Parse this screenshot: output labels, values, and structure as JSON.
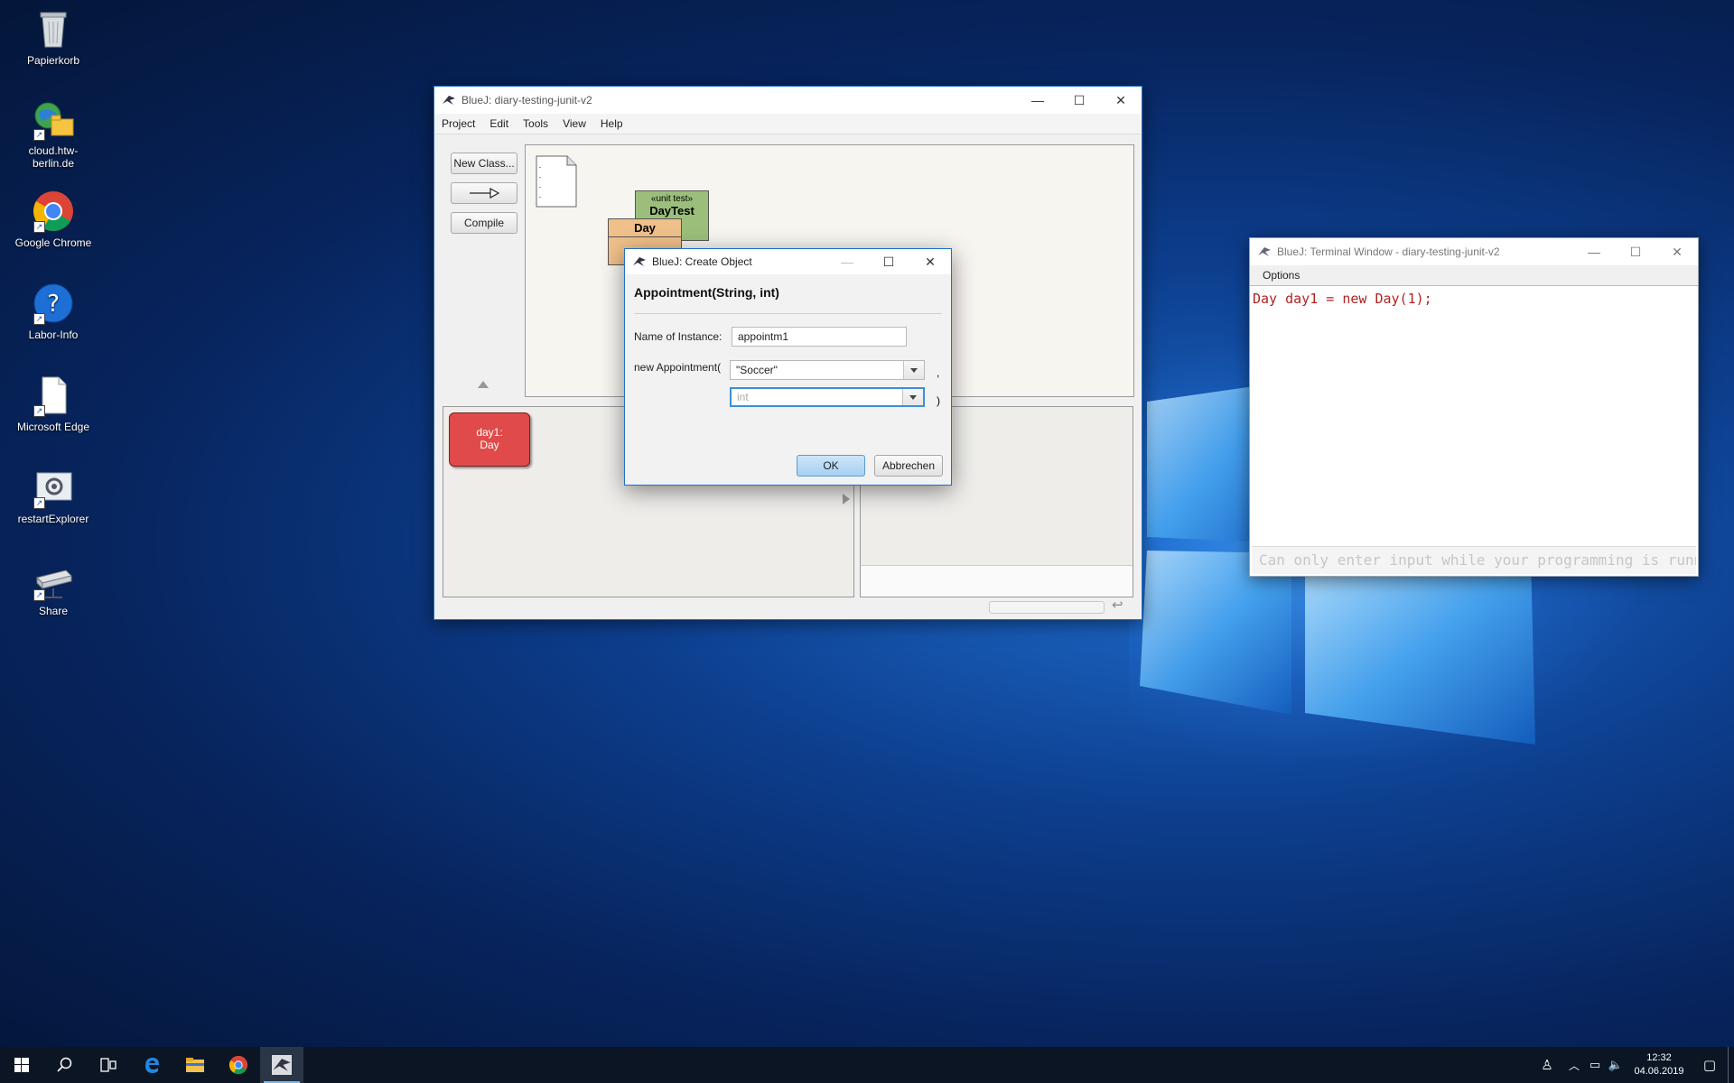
{
  "desktop": {
    "icons": [
      {
        "label": "Papierkorb",
        "icon": "recycle-bin-icon"
      },
      {
        "label": "cloud.htw-berlin.de",
        "icon": "cloud-folder-icon"
      },
      {
        "label": "Google Chrome",
        "icon": "chrome-icon"
      },
      {
        "label": "Labor-Info",
        "icon": "help-icon"
      },
      {
        "label": "Microsoft Edge",
        "icon": "document-icon"
      },
      {
        "label": "restartExplorer",
        "icon": "settings-icon"
      },
      {
        "label": "Share",
        "icon": "network-drive-icon"
      }
    ]
  },
  "bluej": {
    "title": "BlueJ:  diary-testing-junit-v2",
    "menu": [
      "Project",
      "Edit",
      "Tools",
      "View",
      "Help"
    ],
    "buttons": {
      "new_class": "New Class...",
      "compile": "Compile"
    },
    "classes": {
      "unit_test_stereotype": "«unit test»",
      "unit_test_name": "DayTest",
      "day_name": "Day"
    },
    "object_bench": {
      "object_line1": "day1:",
      "object_line2": "Day"
    }
  },
  "dialog": {
    "title": "BlueJ:  Create Object",
    "signature": "Appointment(String, int)",
    "name_label": "Name of Instance:",
    "name_value": "appointm1",
    "constructor_label": "new Appointment(",
    "arg1_value": "\"Soccer\"",
    "arg1_suffix": ",",
    "arg2_placeholder": "int",
    "arg2_suffix": ")",
    "ok": "OK",
    "cancel": "Abbrechen"
  },
  "terminal": {
    "title": "BlueJ: Terminal Window - diary-testing-junit-v2",
    "menu_options": "Options",
    "output": "Day day1 = new Day(1);",
    "input_placeholder": "Can only enter input while your programming is running"
  },
  "taskbar": {
    "time": "12:32",
    "date": "04.06.2019"
  },
  "colors": {
    "accent": "#1e6fc7",
    "object_red": "#e04a4a",
    "unit_test_green": "#9bbf7a",
    "class_orange": "#f0c08a",
    "terminal_text": "#b22222"
  }
}
